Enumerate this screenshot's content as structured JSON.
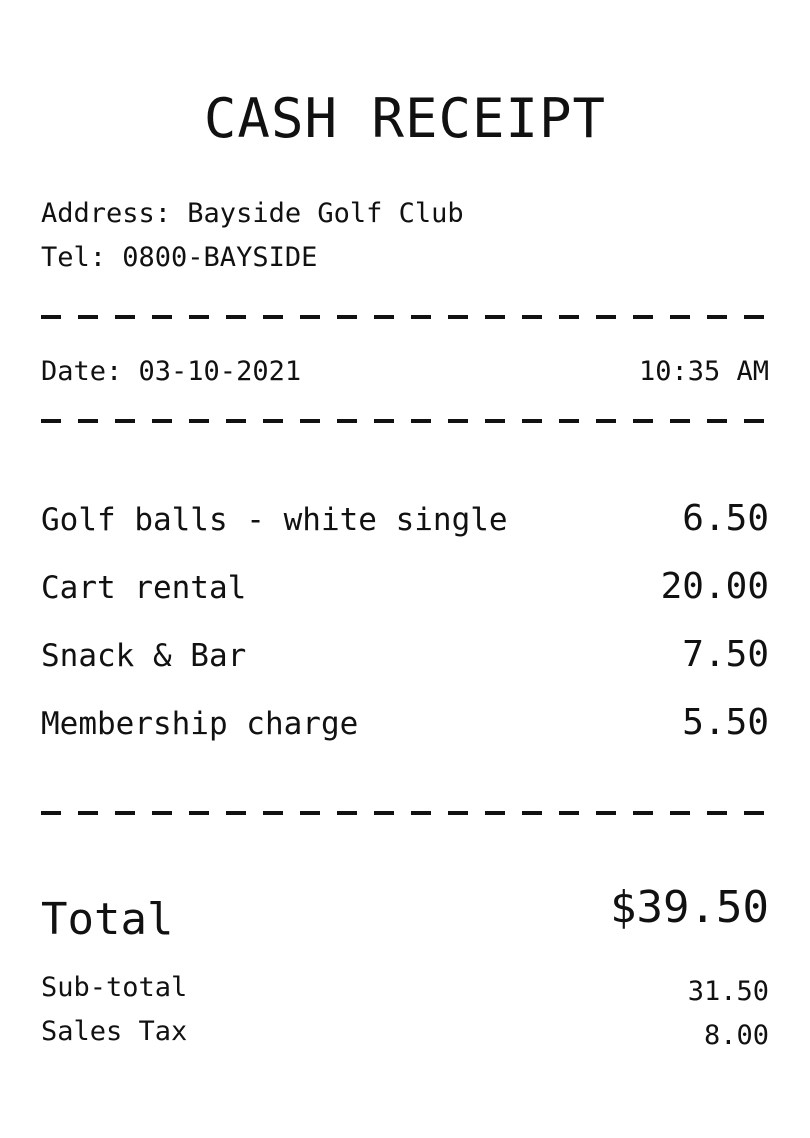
{
  "receipt": {
    "title": "CASH RECEIPT",
    "address": "Address: Bayside Golf Club",
    "tel": "Tel: 0800-BAYSIDE",
    "date": "Date: 03-10-2021",
    "time": "10:35 AM",
    "items": [
      {
        "name": "Golf balls - white single",
        "price": "6.50"
      },
      {
        "name": "Cart rental",
        "price": "20.00"
      },
      {
        "name": "Snack & Bar",
        "price": "7.50"
      },
      {
        "name": "Membership charge",
        "price": "5.50"
      }
    ],
    "total_label": "Total",
    "total_value": "$39.50",
    "subtotal_label": "Sub-total",
    "subtotal_value": "31.50",
    "tax_label": "Sales Tax",
    "tax_value": "8.00"
  }
}
